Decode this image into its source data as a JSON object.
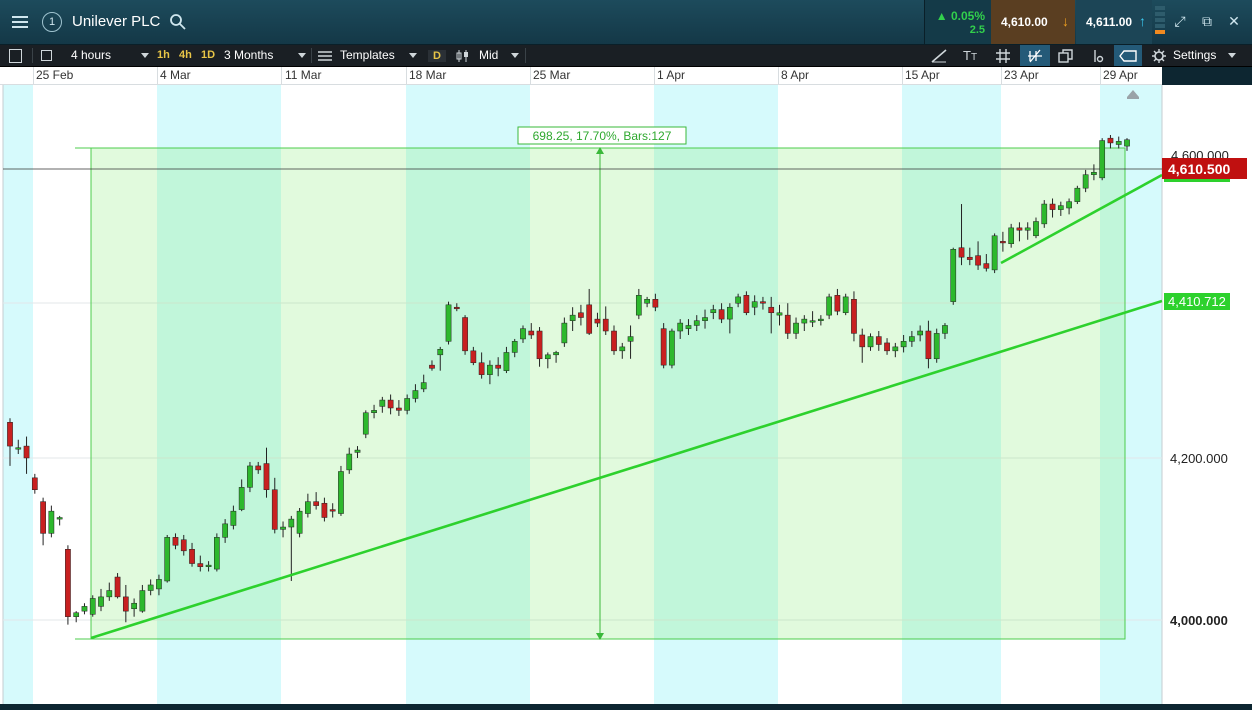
{
  "header": {
    "menu_icon": "hamburger-menu-icon",
    "badge": "1",
    "instrument": "Unilever PLC",
    "search_icon": "magnifier-icon",
    "change_pct": "▲ 0.05%",
    "change_abs": "2.5",
    "sell_price": "4,610.00",
    "sell_arrow": "↓",
    "buy_price": "4,611.00",
    "buy_arrow": "↑",
    "colors": {
      "up": "#32d04c",
      "sell_bg": "#5a3e21",
      "buy_bg": "#1c4556",
      "sell_arrow": "#f0a020",
      "buy_arrow": "#3cc8f0"
    }
  },
  "toolbar": {
    "interval": "4 hours",
    "quick_intervals": [
      "1h",
      "4h",
      "1D"
    ],
    "range": "3 Months",
    "templates": "Templates",
    "d_button": "D",
    "price_type": "Mid",
    "settings": "Settings"
  },
  "chart_data": {
    "type": "candlestick",
    "x_labels": [
      "25 Feb",
      "4 Mar",
      "11 Mar",
      "18 Mar",
      "25 Mar",
      "1 Apr",
      "8 Apr",
      "15 Apr",
      "23 Apr",
      "29 Apr"
    ],
    "y_ticks": [
      "4,000.000",
      "4,200.000"
    ],
    "y_partial_tick": "4,600.000",
    "ylim": [
      3895,
      4675
    ],
    "current_price": "4,610.500",
    "trendline_label": "4,410.712",
    "measure_label": "698.25, 17.70%, Bars:127",
    "measure_range": [
      3978,
      4619
    ],
    "colors": {
      "up": "#2db82d",
      "down": "#c82020",
      "trend": "#2dd12d",
      "price_tag": "#c01010",
      "band_cyan": "#d6fafc",
      "band_pale": "#eafbe6"
    },
    "candles": [
      [
        4250,
        4255,
        4195,
        4220
      ],
      [
        4218,
        4228,
        4210,
        4218
      ],
      [
        4220,
        4232,
        4185,
        4205
      ],
      [
        4180,
        4185,
        4160,
        4165
      ],
      [
        4150,
        4155,
        4095,
        4110
      ],
      [
        4110,
        4145,
        4105,
        4138
      ],
      [
        4128,
        4132,
        4120,
        4130
      ],
      [
        4090,
        4095,
        3995,
        4005
      ],
      [
        4005,
        4012,
        3998,
        4010
      ],
      [
        4012,
        4022,
        4008,
        4018
      ],
      [
        4008,
        4032,
        4005,
        4028
      ],
      [
        4018,
        4040,
        4012,
        4030
      ],
      [
        4030,
        4048,
        4025,
        4038
      ],
      [
        4055,
        4060,
        4028,
        4030
      ],
      [
        4030,
        4045,
        3998,
        4012
      ],
      [
        4015,
        4028,
        4005,
        4022
      ],
      [
        4012,
        4045,
        4010,
        4038
      ],
      [
        4038,
        4052,
        4032,
        4045
      ],
      [
        4040,
        4058,
        4032,
        4052
      ],
      [
        4050,
        4108,
        4048,
        4105
      ],
      [
        4105,
        4110,
        4090,
        4095
      ],
      [
        4102,
        4108,
        4082,
        4088
      ],
      [
        4090,
        4098,
        4068,
        4072
      ],
      [
        4072,
        4082,
        4062,
        4068
      ],
      [
        4068,
        4075,
        4062,
        4070
      ],
      [
        4065,
        4110,
        4062,
        4105
      ],
      [
        4105,
        4128,
        4098,
        4122
      ],
      [
        4120,
        4145,
        4115,
        4138
      ],
      [
        4140,
        4178,
        4138,
        4168
      ],
      [
        4168,
        4200,
        4162,
        4195
      ],
      [
        4195,
        4200,
        4185,
        4190
      ],
      [
        4198,
        4218,
        4155,
        4165
      ],
      [
        4165,
        4180,
        4110,
        4115
      ],
      [
        4115,
        4125,
        4105,
        4118
      ],
      [
        4118,
        4132,
        4050,
        4128
      ],
      [
        4110,
        4142,
        4105,
        4138
      ],
      [
        4135,
        4160,
        4130,
        4150
      ],
      [
        4150,
        4162,
        4140,
        4145
      ],
      [
        4148,
        4155,
        4125,
        4130
      ],
      [
        4140,
        4148,
        4130,
        4138
      ],
      [
        4135,
        4195,
        4132,
        4188
      ],
      [
        4190,
        4218,
        4185,
        4210
      ],
      [
        4212,
        4220,
        4205,
        4215
      ],
      [
        4235,
        4265,
        4230,
        4262
      ],
      [
        4262,
        4272,
        4255,
        4265
      ],
      [
        4270,
        4282,
        4262,
        4278
      ],
      [
        4278,
        4285,
        4260,
        4268
      ],
      [
        4268,
        4278,
        4258,
        4265
      ],
      [
        4265,
        4285,
        4260,
        4280
      ],
      [
        4280,
        4298,
        4275,
        4290
      ],
      [
        4292,
        4310,
        4288,
        4300
      ],
      [
        4322,
        4328,
        4315,
        4318
      ],
      [
        4335,
        4345,
        4315,
        4342
      ],
      [
        4352,
        4402,
        4348,
        4398
      ],
      [
        4395,
        4400,
        4390,
        4393
      ],
      [
        4382,
        4385,
        4335,
        4340
      ],
      [
        4340,
        4345,
        4322,
        4325
      ],
      [
        4325,
        4338,
        4305,
        4310
      ],
      [
        4310,
        4328,
        4298,
        4322
      ],
      [
        4322,
        4332,
        4308,
        4318
      ],
      [
        4315,
        4345,
        4312,
        4338
      ],
      [
        4338,
        4355,
        4332,
        4352
      ],
      [
        4355,
        4372,
        4350,
        4368
      ],
      [
        4365,
        4375,
        4355,
        4360
      ],
      [
        4365,
        4370,
        4320,
        4330
      ],
      [
        4330,
        4338,
        4318,
        4335
      ],
      [
        4335,
        4340,
        4325,
        4338
      ],
      [
        4350,
        4382,
        4345,
        4375
      ],
      [
        4378,
        4395,
        4365,
        4385
      ],
      [
        4388,
        4398,
        4372,
        4382
      ],
      [
        4398,
        4418,
        4360,
        4362
      ],
      [
        4380,
        4388,
        4370,
        4375
      ],
      [
        4380,
        4396,
        4360,
        4365
      ],
      [
        4365,
        4372,
        4335,
        4340
      ],
      [
        4340,
        4350,
        4330,
        4345
      ],
      [
        4352,
        4372,
        4330,
        4358
      ],
      [
        4385,
        4418,
        4380,
        4410
      ],
      [
        4400,
        4408,
        4395,
        4405
      ],
      [
        4405,
        4412,
        4390,
        4395
      ],
      [
        4368,
        4375,
        4318,
        4322
      ],
      [
        4322,
        4368,
        4318,
        4365
      ],
      [
        4365,
        4380,
        4355,
        4375
      ],
      [
        4368,
        4380,
        4360,
        4372
      ],
      [
        4372,
        4385,
        4365,
        4378
      ],
      [
        4378,
        4392,
        4368,
        4382
      ],
      [
        4388,
        4398,
        4380,
        4392
      ],
      [
        4392,
        4400,
        4375,
        4380
      ],
      [
        4380,
        4400,
        4362,
        4395
      ],
      [
        4400,
        4412,
        4395,
        4408
      ],
      [
        4410,
        4415,
        4385,
        4388
      ],
      [
        4395,
        4410,
        4385,
        4402
      ],
      [
        4402,
        4408,
        4392,
        4400
      ],
      [
        4395,
        4408,
        4362,
        4388
      ],
      [
        4385,
        4398,
        4372,
        4388
      ],
      [
        4385,
        4400,
        4355,
        4362
      ],
      [
        4362,
        4382,
        4355,
        4375
      ],
      [
        4375,
        4385,
        4365,
        4380
      ],
      [
        4378,
        4390,
        4370,
        4378
      ],
      [
        4378,
        4385,
        4372,
        4380
      ],
      [
        4385,
        4412,
        4380,
        4408
      ],
      [
        4410,
        4418,
        4385,
        4390
      ],
      [
        4388,
        4412,
        4385,
        4408
      ],
      [
        4405,
        4415,
        4352,
        4362
      ],
      [
        4360,
        4368,
        4325,
        4345
      ],
      [
        4345,
        4362,
        4340,
        4358
      ],
      [
        4358,
        4365,
        4340,
        4348
      ],
      [
        4350,
        4356,
        4335,
        4340
      ],
      [
        4340,
        4350,
        4332,
        4345
      ],
      [
        4345,
        4360,
        4338,
        4352
      ],
      [
        4352,
        4365,
        4345,
        4358
      ],
      [
        4360,
        4372,
        4352,
        4365
      ],
      [
        4365,
        4378,
        4318,
        4330
      ],
      [
        4330,
        4368,
        4325,
        4362
      ],
      [
        4362,
        4375,
        4355,
        4372
      ],
      [
        4402,
        4470,
        4398,
        4468
      ],
      [
        4470,
        4525,
        4448,
        4458
      ],
      [
        4458,
        4470,
        4448,
        4455
      ],
      [
        4460,
        4478,
        4442,
        4448
      ],
      [
        4450,
        4462,
        4440,
        4444
      ],
      [
        4442,
        4488,
        4438,
        4485
      ],
      [
        4478,
        4490,
        4465,
        4476
      ],
      [
        4475,
        4500,
        4470,
        4495
      ],
      [
        4495,
        4502,
        4478,
        4492
      ],
      [
        4492,
        4502,
        4480,
        4495
      ],
      [
        4485,
        4508,
        4482,
        4503
      ],
      [
        4500,
        4530,
        4495,
        4525
      ],
      [
        4525,
        4532,
        4508,
        4518
      ],
      [
        4518,
        4528,
        4510,
        4523
      ],
      [
        4520,
        4532,
        4512,
        4528
      ],
      [
        4528,
        4548,
        4525,
        4545
      ],
      [
        4545,
        4568,
        4540,
        4562
      ],
      [
        4562,
        4575,
        4555,
        4565
      ],
      [
        4558,
        4608,
        4555,
        4605
      ],
      [
        4608,
        4612,
        4595,
        4602
      ],
      [
        4600,
        4610,
        4595,
        4604
      ],
      [
        4598,
        4608,
        4592,
        4606
      ]
    ]
  },
  "right_panel": {
    "toolbar_icons": [
      "draw-line-icon",
      "text-tool-icon",
      "grid-icon",
      "indicator-icon",
      "layers-icon",
      "crosshair-icon",
      "tag-icon",
      "gear-icon"
    ]
  }
}
